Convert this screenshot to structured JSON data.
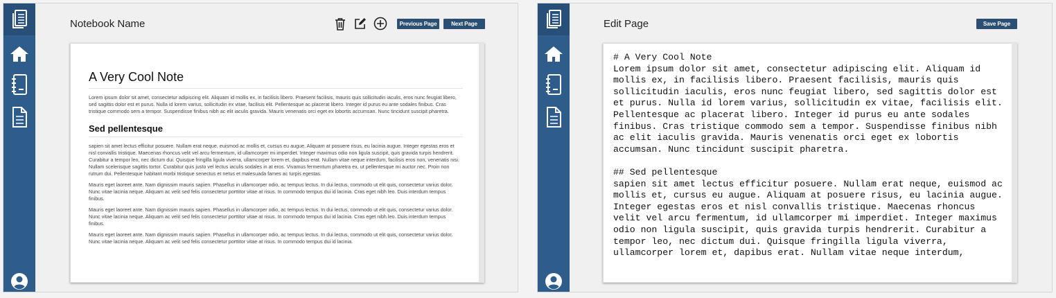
{
  "sidebar": {
    "icons": [
      "notebooks-icon",
      "home-icon",
      "notebook-icon",
      "page-icon",
      "user-icon"
    ]
  },
  "left_panel": {
    "title": "Notebook Name",
    "buttons": {
      "previous": "Previous Page",
      "next": "Next Page"
    },
    "note": {
      "h1": "A Very Cool Note",
      "p1": "Lorem ipsum dolor sit amet, consectetur adipiscing elit. Aliquam id mollis ex, in facilisis libero. Praesent facilisis, mauris quis sollicitudin iaculis, eros nunc feugiat libero, sed sagittis dolor est et purus. Nulla id lorem varius, sollicitudin ex vitae, facilisis elit. Pellentesque ac placerat libero. Integer id purus eu ante sodales finibus. Cras tristique commodo sem a tempor. Suspendisse finibus nibh ac elit iaculis gravida. Mauris venenatis orci eget ex lobortis accumsan. Nunc tincidunt suscipit pharetra.",
      "h2": "Sed pellentesque",
      "p2": "sapien sit amet lectus efficitur posuere. Nullam erat neque, euismod ac mollis et, cursus eu augue. Aliquam at posuere risus, eu lacinia augue. Integer egestas eros et nisl convallis tristique. Maecenas rhoncus velit vel arcu fermentum, id ullamcorper mi imperdiet. Integer maximus odio non ligula suscipit, quis gravida turpis hendrerit. Curabitur a tempor leo, nec dictum dui. Quisque fringilla ligula viverra, ullamcorper lorem et, dapibus erat. Nullam vitae neque interdum, facilisis eros non, venenatis nisi. Nullam scelerisque sagittis tortor. Curabitur quis justo vel lectus iaculis sodales in at eros. Vivamus fermentum pharetra ex, ut pellentesque mi auctor nec. Proin non rutrum dui. Pellentesque habitant morbi tristique senectus et netus et malesuada fames ac turpis egestas.",
      "p3": "Mauris eget laoreet ante. Nam dignissim mauris sapien. Phasellus in ullamcorper odio, ac tempus lectus. In dui lectus, commodo ut elit quis, consectetur varius dolor. Nunc vitae lacinia neque. Aliquam ac velit sed felis consectetur porttitor vitae at risus. In commodo tempus dui id lacinia. Cras eget nibh leo. Duis interdum tempus finibus.",
      "p4": "Mauris eget laoreet ante. Nam dignissim mauris sapien. Phasellus in ullamcorper odio, ac tempus lectus. In dui lectus, commodo ut elit quis, consectetur varius dolor. Nunc vitae lacinia neque. Aliquam ac velit sed felis consectetur porttitor vitae at risus. In commodo tempus dui id lacinia. Cras eget nibh leo. Duis interdum tempus finibus.",
      "p5": "Mauris eget laoreet ante. Nam dignissim mauris sapien. Phasellus in ullamcorper odio, ac tempus lectus. In dui lectus, commodo ut elit quis, consectetur varius dolor. Nunc vitae lacinia neque. Aliquam ac velit sed felis consectetur porttitor vitae at risus. In commodo tempus dui id lacinia."
    }
  },
  "right_panel": {
    "title": "Edit Page",
    "buttons": {
      "save": "Save Page"
    },
    "editor": {
      "line1": "# A Very Cool Note",
      "para1": "Lorem ipsum dolor sit amet, consectetur adipiscing elit. Aliquam id mollis ex, in facilisis libero. Praesent facilisis, mauris quis sollicitudin iaculis, eros nunc feugiat libero, sed sagittis dolor est et purus. Nulla id lorem varius, sollicitudin ex vitae, facilisis elit. Pellentesque ac placerat libero. Integer id purus eu ante sodales finibus. Cras tristique commodo sem a tempor. Suspendisse finibus nibh ac elit iaculis gravida. Mauris venenatis orci eget ex lobortis accumsan. Nunc tincidunt suscipit pharetra.",
      "line2": "## Sed pellentesque",
      "para2": "sapien sit amet lectus efficitur posuere. Nullam erat neque, euismod ac mollis et, cursus eu augue. Aliquam at posuere risus, eu lacinia augue. Integer egestas eros et nisl convallis tristique. Maecenas rhoncus velit vel arcu fermentum, id ullamcorper mi imperdiet. Integer maximus odio non ligula suscipit, quis gravida turpis hendrerit. Curabitur a tempor leo, nec dictum dui. Quisque fringilla ligula viverra, ullamcorper lorem et, dapibus erat. Nullam vitae neque interdum,"
    }
  },
  "colors": {
    "sidebar": "#2e5d8c",
    "sidebar_active": "#274f78",
    "button": "#2a4f73"
  }
}
